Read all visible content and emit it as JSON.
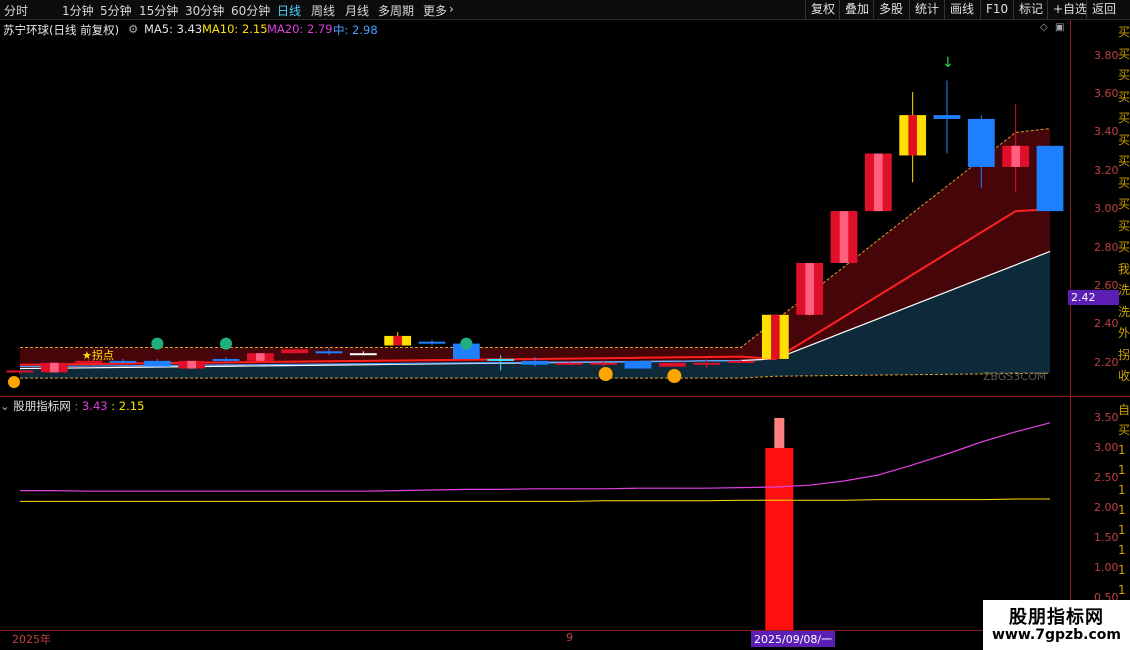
{
  "periods": [
    "分时",
    "1分钟",
    "5分钟",
    "15分钟",
    "30分钟",
    "60分钟",
    "日线",
    "周线",
    "月线",
    "多周期",
    "更多"
  ],
  "active_period": "日线",
  "tools": [
    "复权",
    "叠加",
    "多股",
    "统计",
    "画线",
    "F10",
    "标记",
    "+自选",
    "返回"
  ],
  "stock": {
    "name": "苏宁环球(日线 前复权)"
  },
  "ma": {
    "ma5": "MA5: 3.43",
    "ma10": "MA10: 2.15",
    "ma20": "MA20: 2.79",
    "mid": "中: 2.98",
    "colors": {
      "ma5": "#e0e0e0",
      "ma10": "#ffe100",
      "ma20": "#e040e0",
      "mid": "#4aa0ff"
    }
  },
  "price_axis": [
    "3.80",
    "3.60",
    "3.40",
    "3.20",
    "3.00",
    "2.80",
    "2.60",
    "2.40",
    "2.20"
  ],
  "current_price": "2.42",
  "chart_watermark": "ZBGS3COM",
  "pivot_label": "★拐点",
  "sub_indicator": {
    "name": "股朋指标网",
    "v1": ": 3.43",
    "v2": ": 2.15"
  },
  "sub_axis": [
    "3.50",
    "3.00",
    "2.50",
    "2.00",
    "1.50",
    "1.00",
    "0.50"
  ],
  "dates": {
    "year": "2025年",
    "month": "9",
    "cursor": "2025/09/08/一"
  },
  "site": {
    "name": "股朋指标网",
    "url": "www.7gpzb.com"
  },
  "right_edge_chars": [
    "买",
    "买",
    "买",
    "买",
    "买",
    "买",
    "买",
    "买",
    "买",
    "买",
    "买",
    "我",
    "洗",
    "洗",
    "外",
    "拐",
    "收"
  ],
  "sub_right_chars": [
    "自",
    "买",
    "1",
    "1",
    "1",
    "1",
    "1",
    "1",
    "1",
    "1"
  ],
  "chart_data": {
    "type": "candlestick",
    "price_range": [
      2.1,
      3.85
    ],
    "candles": [
      {
        "o": 2.15,
        "c": 2.16,
        "h": 2.16,
        "l": 2.14,
        "col": "red"
      },
      {
        "o": 2.15,
        "c": 2.2,
        "h": 2.2,
        "l": 2.15,
        "col": "red"
      },
      {
        "o": 2.2,
        "c": 2.21,
        "h": 2.22,
        "l": 2.19,
        "col": "red"
      },
      {
        "o": 2.2,
        "c": 2.21,
        "h": 2.22,
        "l": 2.2,
        "col": "blue"
      },
      {
        "o": 2.21,
        "c": 2.18,
        "h": 2.22,
        "l": 2.18,
        "col": "blue"
      },
      {
        "o": 2.17,
        "c": 2.21,
        "h": 2.21,
        "l": 2.17,
        "col": "red"
      },
      {
        "o": 2.22,
        "c": 2.21,
        "h": 2.23,
        "l": 2.2,
        "col": "blue"
      },
      {
        "o": 2.21,
        "c": 2.25,
        "h": 2.25,
        "l": 2.21,
        "col": "red"
      },
      {
        "o": 2.25,
        "c": 2.27,
        "h": 2.27,
        "l": 2.25,
        "col": "red"
      },
      {
        "o": 2.26,
        "c": 2.26,
        "h": 2.28,
        "l": 2.24,
        "col": "blue"
      },
      {
        "o": 2.25,
        "c": 2.25,
        "h": 2.26,
        "l": 2.24,
        "col": "white"
      },
      {
        "o": 2.29,
        "c": 2.34,
        "h": 2.36,
        "l": 2.29,
        "col": "yellow"
      },
      {
        "o": 2.3,
        "c": 2.31,
        "h": 2.32,
        "l": 2.29,
        "col": "blue"
      },
      {
        "o": 2.3,
        "c": 2.22,
        "h": 2.31,
        "l": 2.22,
        "col": "blue"
      },
      {
        "o": 2.22,
        "c": 2.22,
        "h": 2.24,
        "l": 2.16,
        "col": "cyan"
      },
      {
        "o": 2.21,
        "c": 2.19,
        "h": 2.23,
        "l": 2.18,
        "col": "blue"
      },
      {
        "o": 2.2,
        "c": 2.2,
        "h": 2.21,
        "l": 2.19,
        "col": "red"
      },
      {
        "o": 2.2,
        "c": 2.19,
        "h": 2.21,
        "l": 2.18,
        "col": "red"
      },
      {
        "o": 2.21,
        "c": 2.17,
        "h": 2.21,
        "l": 2.17,
        "col": "blue"
      },
      {
        "o": 2.2,
        "c": 2.18,
        "h": 2.2,
        "l": 2.18,
        "col": "red"
      },
      {
        "o": 2.2,
        "c": 2.2,
        "h": 2.22,
        "l": 2.17,
        "col": "red"
      },
      {
        "o": 2.21,
        "c": 2.21,
        "h": 2.22,
        "l": 2.2,
        "col": "red"
      },
      {
        "o": 2.22,
        "c": 2.45,
        "h": 2.45,
        "l": 2.22,
        "col": "yellow"
      },
      {
        "o": 2.45,
        "c": 2.72,
        "h": 2.72,
        "l": 2.44,
        "col": "red"
      },
      {
        "o": 2.72,
        "c": 2.99,
        "h": 2.99,
        "l": 2.72,
        "col": "red"
      },
      {
        "o": 2.99,
        "c": 3.29,
        "h": 3.29,
        "l": 2.99,
        "col": "red"
      },
      {
        "o": 3.28,
        "c": 3.49,
        "h": 3.61,
        "l": 3.14,
        "col": "yellow"
      },
      {
        "o": 3.49,
        "c": 3.47,
        "h": 3.67,
        "l": 3.29,
        "col": "blue"
      },
      {
        "o": 3.47,
        "c": 3.22,
        "h": 3.49,
        "l": 3.11,
        "col": "blue"
      },
      {
        "o": 3.22,
        "c": 3.33,
        "h": 3.55,
        "l": 3.09,
        "col": "red"
      },
      {
        "o": 3.33,
        "c": 2.99,
        "h": 3.33,
        "l": 2.99,
        "col": "blue"
      }
    ],
    "sub_chart": {
      "range": [
        0,
        3.7
      ],
      "spike": {
        "index": 22,
        "value": 3.0,
        "top": 3.5
      },
      "line_pink": [
        2.29,
        2.29,
        2.28,
        2.28,
        2.28,
        2.28,
        2.28,
        2.28,
        2.28,
        2.28,
        2.28,
        2.29,
        2.3,
        2.31,
        2.31,
        2.32,
        2.32,
        2.32,
        2.33,
        2.33,
        2.33,
        2.34,
        2.35,
        2.38,
        2.45,
        2.55,
        2.72,
        2.9,
        3.1,
        3.27,
        3.42
      ],
      "line_yellow": [
        2.11,
        2.11,
        2.11,
        2.11,
        2.11,
        2.11,
        2.11,
        2.11,
        2.11,
        2.11,
        2.11,
        2.11,
        2.11,
        2.11,
        2.11,
        2.11,
        2.11,
        2.12,
        2.12,
        2.12,
        2.12,
        2.13,
        2.13,
        2.13,
        2.13,
        2.14,
        2.14,
        2.14,
        2.14,
        2.15,
        2.15
      ]
    }
  }
}
